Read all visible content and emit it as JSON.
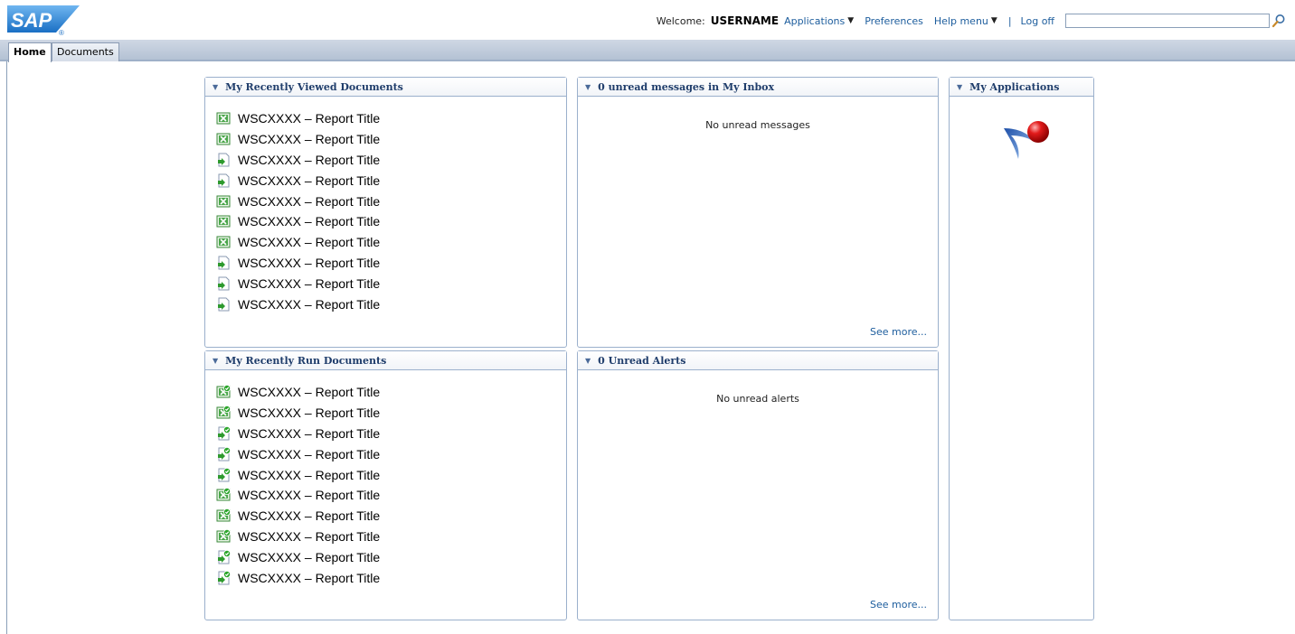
{
  "logo": {
    "text": "SAP",
    "mark": "®"
  },
  "header": {
    "welcome_label": "Welcome:",
    "username": "USERNAME",
    "applications_label": "Applications",
    "preferences_label": "Preferences",
    "help_label": "Help menu",
    "separator": "|",
    "logoff_label": "Log off",
    "search_value": "",
    "caret_icon": "caret-down-icon",
    "search_icon": "magnifier-icon"
  },
  "tabs": [
    {
      "label": "Home",
      "active": true
    },
    {
      "label": "Documents",
      "active": false
    }
  ],
  "panels": {
    "viewed": {
      "title": "My Recently Viewed Documents",
      "items": [
        {
          "label": "WSCXXXX – Report Title",
          "icon": "excel-document-icon"
        },
        {
          "label": "WSCXXXX – Report Title",
          "icon": "excel-document-icon"
        },
        {
          "label": "WSCXXXX – Report Title",
          "icon": "web-document-icon"
        },
        {
          "label": "WSCXXXX – Report Title",
          "icon": "web-document-icon"
        },
        {
          "label": "WSCXXXX – Report Title",
          "icon": "excel-document-icon"
        },
        {
          "label": "WSCXXXX – Report Title",
          "icon": "excel-document-icon"
        },
        {
          "label": "WSCXXXX – Report Title",
          "icon": "excel-document-icon"
        },
        {
          "label": "WSCXXXX – Report Title",
          "icon": "web-document-icon"
        },
        {
          "label": "WSCXXXX – Report Title",
          "icon": "web-document-icon"
        },
        {
          "label": "WSCXXXX – Report Title",
          "icon": "web-document-icon"
        }
      ]
    },
    "run": {
      "title": "My Recently Run Documents",
      "items": [
        {
          "label": "WSCXXXX – Report Title",
          "icon": "excel-run-icon"
        },
        {
          "label": "WSCXXXX – Report Title",
          "icon": "excel-run-icon"
        },
        {
          "label": "WSCXXXX – Report Title",
          "icon": "web-run-icon"
        },
        {
          "label": "WSCXXXX – Report Title",
          "icon": "web-run-icon"
        },
        {
          "label": "WSCXXXX – Report Title",
          "icon": "web-run-icon"
        },
        {
          "label": "WSCXXXX – Report Title",
          "icon": "excel-run-icon"
        },
        {
          "label": "WSCXXXX – Report Title",
          "icon": "excel-run-icon"
        },
        {
          "label": "WSCXXXX – Report Title",
          "icon": "excel-run-icon"
        },
        {
          "label": "WSCXXXX – Report Title",
          "icon": "web-run-icon"
        },
        {
          "label": "WSCXXXX – Report Title",
          "icon": "web-run-icon"
        }
      ]
    },
    "inbox": {
      "title": "0 unread messages in My Inbox",
      "message": "No unread messages",
      "see_more": "See more..."
    },
    "alerts": {
      "title": "0 Unread Alerts",
      "message": "No unread alerts",
      "see_more": "See more..."
    },
    "apps": {
      "title": "My Applications",
      "icon": "application-pushpin-icon"
    }
  },
  "colors": {
    "link": "#1d5d9d",
    "panel_border": "#9bb0cc",
    "tabbar": "#b4c2d4"
  }
}
